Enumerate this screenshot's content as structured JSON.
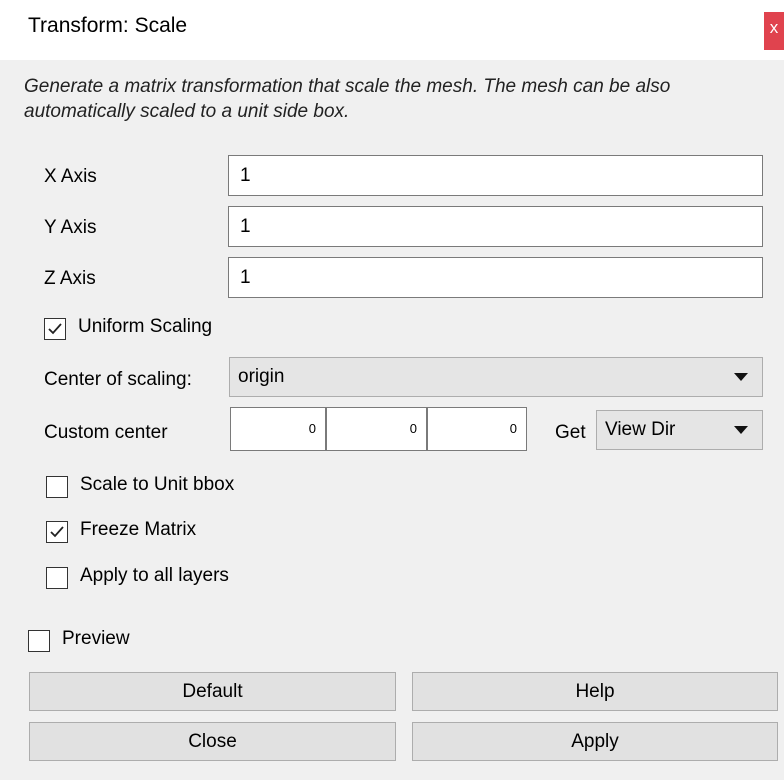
{
  "window": {
    "title": "Transform: Scale",
    "close_glyph": "x"
  },
  "description": "Generate a matrix transformation that scale the mesh. The mesh can be also automatically scaled to a unit side box.",
  "axes": {
    "x": {
      "label": "X Axis",
      "value": "1"
    },
    "y": {
      "label": "Y Axis",
      "value": "1"
    },
    "z": {
      "label": "Z Axis",
      "value": "1"
    }
  },
  "uniform_scaling": {
    "label": "Uniform Scaling",
    "checked": true
  },
  "center_of_scaling": {
    "label": "Center of scaling:",
    "selected": "origin"
  },
  "custom_center": {
    "label": "Custom center",
    "values": [
      "0",
      "0",
      "0"
    ],
    "get_label": "Get",
    "get_selected": "View Dir"
  },
  "scale_to_unit_bbox": {
    "label": "Scale to Unit bbox",
    "checked": false
  },
  "freeze_matrix": {
    "label": "Freeze Matrix",
    "checked": true
  },
  "apply_to_all_layers": {
    "label": "Apply to all layers",
    "checked": false
  },
  "preview": {
    "label": "Preview",
    "checked": false
  },
  "buttons": {
    "default": "Default",
    "help": "Help",
    "close": "Close",
    "apply": "Apply"
  },
  "icons": {
    "close": "close-icon",
    "check": "checkmark-icon",
    "dropdown": "chevron-down-icon"
  },
  "colors": {
    "close_button": "#e0434e",
    "background": "#f0f0f0",
    "input_border": "#7a7a7a"
  }
}
